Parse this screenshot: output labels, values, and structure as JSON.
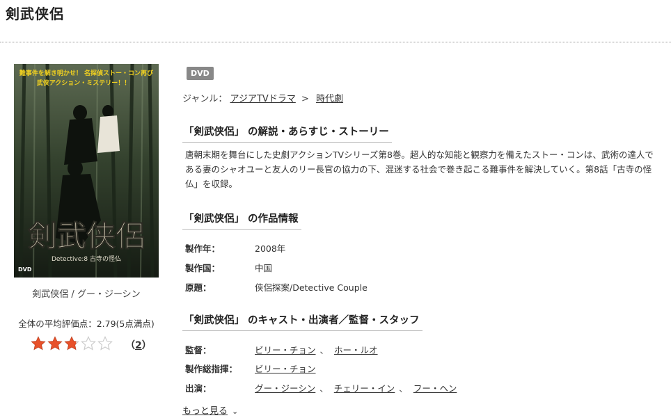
{
  "page": {
    "title": "剣武侠侶"
  },
  "product": {
    "badge": "DVD",
    "cover_text": {
      "tagline_1": "難事件を解き明かせ！ 名探偵ストー・コン再び",
      "tagline_2": "武侠アクション・ミステリー！！",
      "logo": "剣武侠侶",
      "subtitle": "Detective:8 古寺の怪仏",
      "dvd_mark": "DVD"
    },
    "caption": "剣武侠侶 / グー・ジーシン",
    "rating_text": "全体の平均評価点：2.79(5点満点)",
    "rating_value": 2.79,
    "rating_max": 5,
    "review_count_open": "（",
    "review_count": "2",
    "review_count_close": "）"
  },
  "genre": {
    "label": "ジャンル：",
    "parent": "アジアTVドラマ",
    "separator": ">",
    "child": "時代劇"
  },
  "sections": {
    "synopsis_heading": "「剣武侠侶」 の解説・あらすじ・ストーリー",
    "synopsis": "唐朝末期を舞台にした史劇アクションTVシリーズ第8巻。超人的な知能と観察力を備えたストー・コンは、武術の達人である妻のシャオユーと友人のリー長官の協力の下、混迷する社会で巻き起こる難事件を解決していく。第8話「古寺の怪仏」を収録。",
    "info_heading": "「剣武侠侶」 の作品情報",
    "cast_heading": "「剣武侠侶」 のキャスト・出演者／監督・スタッフ"
  },
  "info": {
    "year_label": "製作年：",
    "year_value": "2008年",
    "country_label": "製作国：",
    "country_value": "中国",
    "original_label": "原題：",
    "original_value": "侠侶探案/Detective Couple"
  },
  "staff": {
    "director_label": "監督：",
    "directors": [
      "ビリー・チョン",
      "ホー・ルオ"
    ],
    "supervisor_label": "製作総指揮：",
    "supervisors": [
      "ビリー・チョン"
    ],
    "cast_label": "出演：",
    "cast": [
      "グー・ジーシン",
      "チェリー・イン",
      "フー・ヘン"
    ],
    "comma": "、"
  },
  "more_link": "もっと見る",
  "colors": {
    "star_filled": "#e8512a",
    "star_empty": "#cccccc",
    "badge_bg": "#888888",
    "divider": "#999999"
  },
  "icons": {
    "more": "chevron-down-icon",
    "star": "star-icon"
  }
}
